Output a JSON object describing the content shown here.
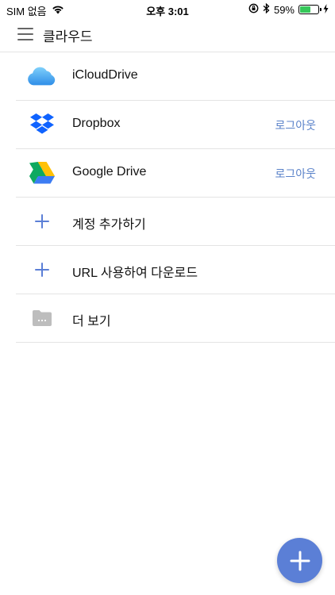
{
  "status": {
    "carrier": "SIM 없음",
    "time": "오후 3:01",
    "battery_percent": "59%",
    "battery_level": 0.59
  },
  "header": {
    "title": "클라우드"
  },
  "list": {
    "items": [
      {
        "label": "iCloudDrive",
        "icon": "icloud-icon",
        "action": ""
      },
      {
        "label": "Dropbox",
        "icon": "dropbox-icon",
        "action": "로그아웃"
      },
      {
        "label": "Google Drive",
        "icon": "google-drive-icon",
        "action": "로그아웃"
      },
      {
        "label": "계정 추가하기",
        "icon": "plus-icon",
        "action": ""
      },
      {
        "label": "URL 사용하여 다운로드",
        "icon": "plus-icon",
        "action": ""
      },
      {
        "label": "더 보기",
        "icon": "folder-icon",
        "action": ""
      }
    ]
  },
  "colors": {
    "accent": "#5b7fd6",
    "link": "#5a82c9",
    "divider": "#e4e4e4"
  }
}
